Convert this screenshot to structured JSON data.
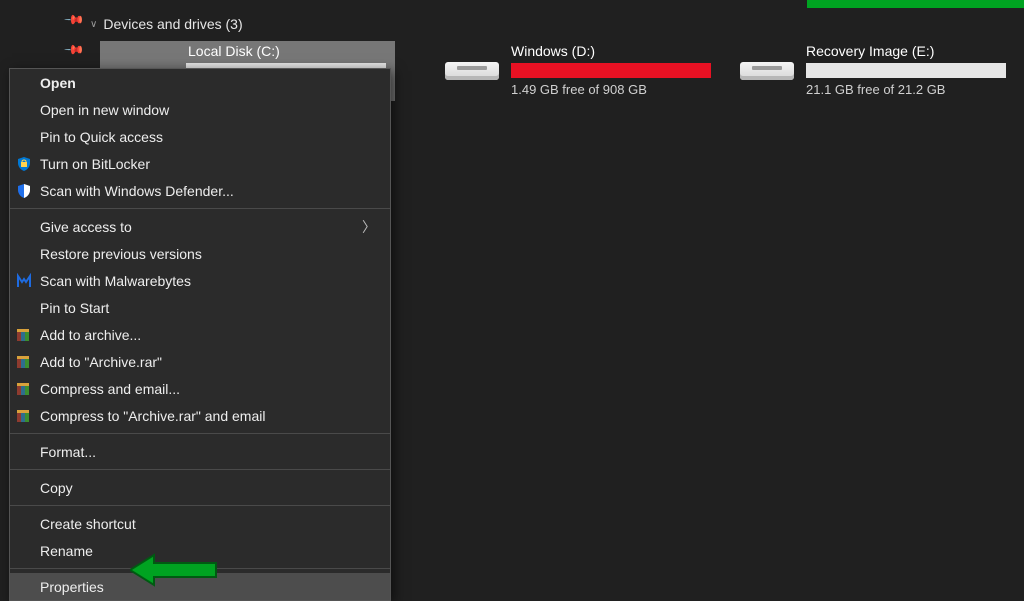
{
  "section_header": "Devices and drives (3)",
  "drives": [
    {
      "name": "Local Disk (C:)",
      "free_text": "",
      "full": false,
      "selected": true
    },
    {
      "name": "Windows (D:)",
      "free_text": "1.49 GB free of 908 GB",
      "full": true,
      "selected": false
    },
    {
      "name": "Recovery Image (E:)",
      "free_text": "21.1 GB free of 21.2 GB",
      "full": false,
      "selected": false
    }
  ],
  "context_menu": [
    {
      "label": "Open",
      "icon": "",
      "bold": true
    },
    {
      "label": "Open in new window",
      "icon": ""
    },
    {
      "label": "Pin to Quick access",
      "icon": ""
    },
    {
      "label": "Turn on BitLocker",
      "icon": "bitlocker"
    },
    {
      "label": "Scan with Windows Defender...",
      "icon": "defender"
    },
    {
      "sep": true
    },
    {
      "label": "Give access to",
      "icon": "",
      "submenu": true
    },
    {
      "label": "Restore previous versions",
      "icon": ""
    },
    {
      "label": "Scan with Malwarebytes",
      "icon": "malwarebytes"
    },
    {
      "label": "Pin to Start",
      "icon": ""
    },
    {
      "label": "Add to archive...",
      "icon": "winrar"
    },
    {
      "label": "Add to \"Archive.rar\"",
      "icon": "winrar"
    },
    {
      "label": "Compress and email...",
      "icon": "winrar"
    },
    {
      "label": "Compress to \"Archive.rar\" and email",
      "icon": "winrar"
    },
    {
      "sep": true
    },
    {
      "label": "Format...",
      "icon": ""
    },
    {
      "sep": true
    },
    {
      "label": "Copy",
      "icon": ""
    },
    {
      "sep": true
    },
    {
      "label": "Create shortcut",
      "icon": ""
    },
    {
      "label": "Rename",
      "icon": ""
    },
    {
      "sep": true
    },
    {
      "label": "Properties",
      "icon": "",
      "highlight": true
    }
  ],
  "icons": {
    "bitlocker": "shield-lock-icon",
    "defender": "shield-icon",
    "malwarebytes": "m-logo-icon",
    "winrar": "books-icon"
  },
  "arrow_color": "#00a321"
}
